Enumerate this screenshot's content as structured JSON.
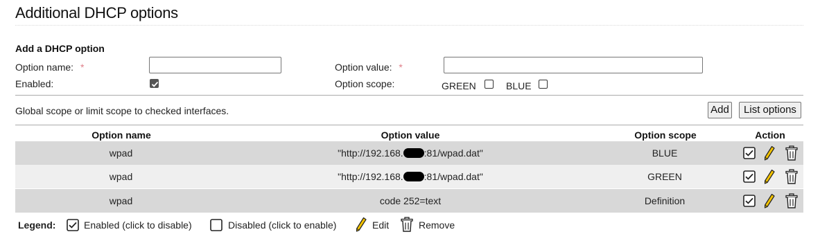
{
  "page": {
    "title": "Additional DHCP options"
  },
  "add_form": {
    "heading": "Add a DHCP option",
    "option_name_label": "Option name:",
    "option_value_label": "Option value:",
    "required_mark": "*",
    "option_name_value": "",
    "option_value_value": "",
    "enabled_label": "Enabled:",
    "enabled_checked": true,
    "option_scope_label": "Option scope:",
    "scope_green_label": "GREEN",
    "scope_green_checked": false,
    "scope_blue_label": "BLUE",
    "scope_blue_checked": false,
    "hint": "Global scope or limit scope to checked interfaces.",
    "add_button": "Add",
    "list_button": "List options"
  },
  "table": {
    "headers": {
      "name": "Option name",
      "value": "Option value",
      "scope": "Option scope",
      "action": "Action"
    },
    "rows": [
      {
        "name": "wpad",
        "value_prefix": "\"http://192.168.",
        "value_suffix": ":81/wpad.dat\"",
        "scope": "BLUE",
        "enabled": true
      },
      {
        "name": "wpad",
        "value_prefix": "\"http://192.168.",
        "value_suffix": ":81/wpad.dat\"",
        "scope": "GREEN",
        "enabled": true
      },
      {
        "name": "wpad",
        "value_prefix": "code 252=text",
        "value_suffix": "",
        "scope": "Definition",
        "enabled": true
      }
    ]
  },
  "legend": {
    "label": "Legend:",
    "enabled": "Enabled (click to disable)",
    "disabled": "Disabled (click to enable)",
    "edit": "Edit",
    "remove": "Remove"
  },
  "icons": {
    "checked": "checkbox-checked-icon",
    "unchecked": "checkbox-unchecked-icon",
    "edit": "pencil-icon",
    "remove": "trash-icon"
  },
  "colors": {
    "row_odd": "#d8d8d8",
    "row_even": "#efefef",
    "pencil": "#f2c200",
    "required": "#e0808a"
  }
}
